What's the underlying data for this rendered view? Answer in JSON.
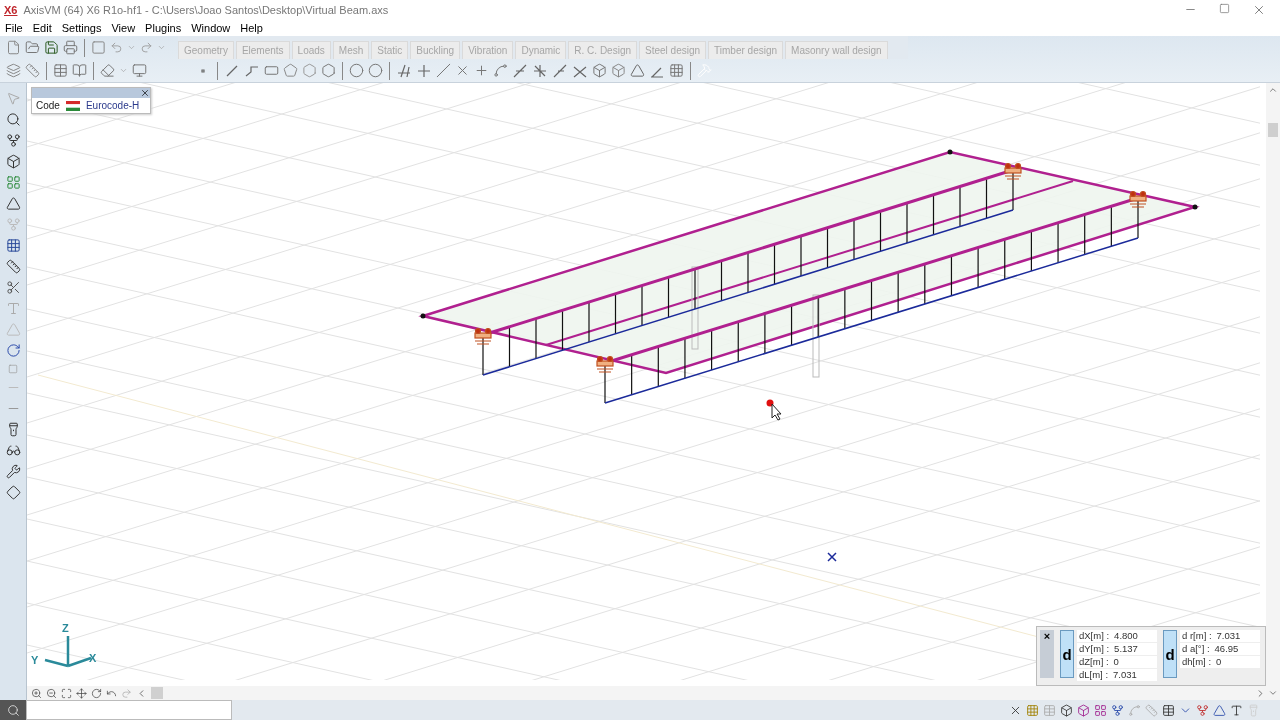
{
  "window": {
    "logo": "X6",
    "title": "AxisVM (64) X6 R1o-hf1 - C:\\Users\\Joao Santos\\Desktop\\Virtual Beam.axs"
  },
  "menu": [
    "File",
    "Edit",
    "Settings",
    "View",
    "Plugins",
    "Window",
    "Help"
  ],
  "tabs": [
    "Geometry",
    "Elements",
    "Loads",
    "Mesh",
    "Static",
    "Buckling",
    "Vibration",
    "Dynamic",
    "R. C. Design",
    "Steel design",
    "Timber design",
    "Masonry wall design"
  ],
  "code_panel": {
    "label": "Code",
    "value": "Eurocode-H"
  },
  "axes": {
    "z": "Z",
    "y": "Y",
    "x": "X"
  },
  "coordinates": {
    "close": "×",
    "groups": [
      {
        "badge": "d",
        "rows": [
          {
            "label": "dX[m] :",
            "value": "4.800"
          },
          {
            "label": "dY[m] :",
            "value": "5.137"
          },
          {
            "label": "dZ[m] :",
            "value": "0"
          },
          {
            "label": "dL[m] :",
            "value": "7.031"
          }
        ]
      },
      {
        "badge": "d",
        "rows": [
          {
            "label": "d r[m] :",
            "value": "7.031"
          },
          {
            "label": "d  a[°] :",
            "value": "46.95"
          },
          {
            "label": "dh[m] :",
            "value": "0"
          }
        ]
      }
    ]
  }
}
